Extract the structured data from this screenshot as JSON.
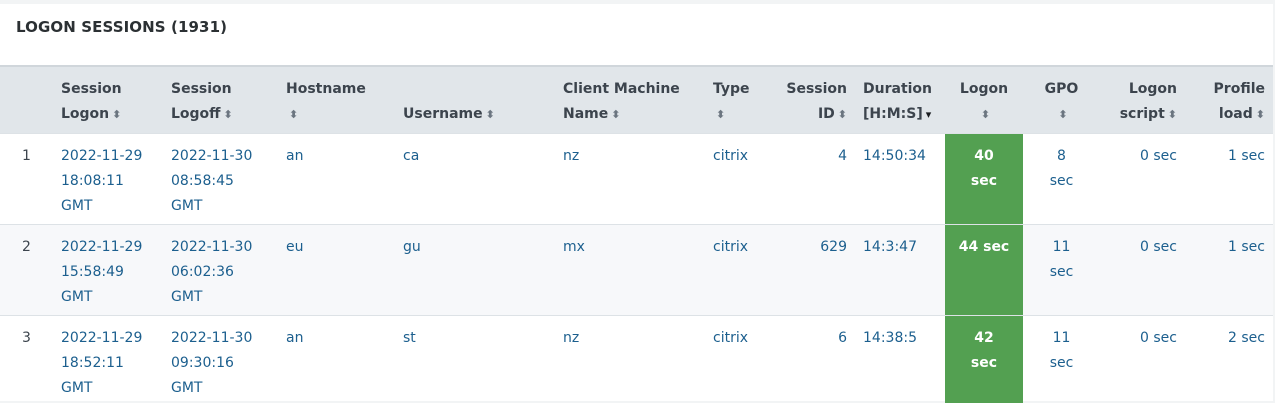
{
  "panel": {
    "title": "LOGON SESSIONS (1931)"
  },
  "columns": [
    {
      "label": "",
      "sort": ""
    },
    {
      "label": "Session Logon",
      "sort": "⬍"
    },
    {
      "label": "Session Logoff",
      "sort": "⬍"
    },
    {
      "label": "Hostname",
      "sort": "⬍"
    },
    {
      "label": "Username",
      "sort": "⬍"
    },
    {
      "label": "Client Machine Name",
      "sort": "⬍"
    },
    {
      "label": "Type",
      "sort": "⬍"
    },
    {
      "label": "Session ID",
      "sort": "⬍"
    },
    {
      "label": "Duration [H:M:S]",
      "sort": "▾"
    },
    {
      "label": "Logon",
      "sort": "⬍"
    },
    {
      "label": "GPO",
      "sort": "⬍"
    },
    {
      "label": "Logon script",
      "sort": "⬍"
    },
    {
      "label": "Profile load",
      "sort": "⬍"
    }
  ],
  "rows": [
    {
      "idx": "1",
      "logon": [
        "2022-11-29",
        "18:08:11",
        "GMT"
      ],
      "logoff": [
        "2022-11-30",
        "08:58:45",
        "GMT"
      ],
      "host": "an",
      "user": "ca",
      "client": "nz",
      "type": "citrix",
      "session_id": "4",
      "duration": "14:50:34",
      "logon_time": [
        "40",
        "sec"
      ],
      "gpo": [
        "8",
        "sec"
      ],
      "script": "0 sec",
      "profile": "1 sec"
    },
    {
      "idx": "2",
      "logon": [
        "2022-11-29",
        "15:58:49",
        "GMT"
      ],
      "logoff": [
        "2022-11-30",
        "06:02:36",
        "GMT"
      ],
      "host": "eu",
      "user": "gu",
      "client": "mx",
      "type": "citrix",
      "session_id": "629",
      "duration": "14:3:47",
      "logon_time": [
        "44 sec"
      ],
      "gpo": [
        "11",
        "sec"
      ],
      "script": "0 sec",
      "profile": "1 sec"
    },
    {
      "idx": "3",
      "logon": [
        "2022-11-29",
        "18:52:11",
        "GMT"
      ],
      "logoff": [
        "2022-11-30",
        "09:30:16",
        "GMT"
      ],
      "host": "an",
      "user": "st",
      "client": "nz",
      "type": "citrix",
      "session_id": "6",
      "duration": "14:38:5",
      "logon_time": [
        "42",
        "sec"
      ],
      "gpo": [
        "11",
        "sec"
      ],
      "script": "0 sec",
      "profile": "2 sec"
    }
  ],
  "colors": {
    "logon_highlight": "#53a051",
    "link": "#1c5f8e",
    "header_bg": "#e1e6ea"
  }
}
